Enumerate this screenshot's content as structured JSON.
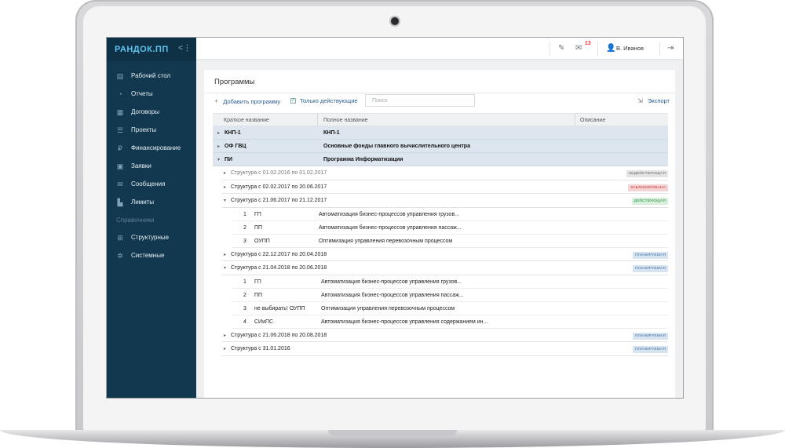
{
  "app": {
    "logo": "РАНДОК.ПП",
    "collapse_icon": "collapse-icon"
  },
  "sidebar": {
    "items": [
      {
        "label": "Рабочий стол",
        "icon": "dashboard-icon"
      },
      {
        "label": "Отчеты",
        "icon": "pie-chart-icon"
      },
      {
        "label": "Договоры",
        "icon": "document-icon"
      },
      {
        "label": "Проекты",
        "icon": "list-icon"
      },
      {
        "label": "Финансирование",
        "icon": "ruble-icon"
      },
      {
        "label": "Заявки",
        "icon": "form-icon"
      },
      {
        "label": "Сообщения",
        "icon": "envelope-icon"
      },
      {
        "label": "Лимиты",
        "icon": "bar-chart-icon"
      }
    ],
    "section_title": "Справочники",
    "refs": [
      {
        "label": "Структурные",
        "icon": "hierarchy-icon"
      },
      {
        "label": "Системные",
        "icon": "gears-icon"
      }
    ]
  },
  "topbar": {
    "notifications_count": "13",
    "user_name": "В. Иванов"
  },
  "panel": {
    "title": "Программы",
    "add_label": "Добавить программу",
    "active_only_label": "Только действующие",
    "search_placeholder": "Поиск",
    "export_label": "Экспорт"
  },
  "table": {
    "columns": [
      "Краткое название",
      "Полное название",
      "Описание"
    ],
    "groups": [
      {
        "code": "КНП-1",
        "full": "КНП-1",
        "arrow": "▸"
      },
      {
        "code": "ОФ ГВЦ",
        "full": "Основные фонды главного вычислительного центра",
        "arrow": "▸"
      },
      {
        "code": "ПИ",
        "full": "Программа Информатизации",
        "arrow": "▾"
      }
    ],
    "structures": [
      {
        "label": "Структура с 01.02.2016  по 01.02.2017",
        "badge": "недействующая",
        "arrow": "▸"
      },
      {
        "label": "Структура с 02.02.2017  по 20.06.2017",
        "badge": "заблокирована",
        "arrow": "▸"
      },
      {
        "label": "Структура с 21.06.2017  по 21.12.2017",
        "badge": "действующая",
        "arrow": "▾",
        "items": [
          {
            "num": "1",
            "code": "ГП",
            "desc": "Автоматизация бизнес-процессов управления грузов..."
          },
          {
            "num": "2",
            "code": "ПП",
            "desc": "Автоматизация бизнес-процессов управления пассаж..."
          },
          {
            "num": "3",
            "code": "ОУПП",
            "desc": "Оптимизация управления перевозочным процессом"
          }
        ]
      },
      {
        "label": "Структура с 22.12.2017  по 20.04.2018",
        "badge": "планируемая",
        "arrow": "▸"
      },
      {
        "label": "Структура с 21.04.2018  по 20.06.2018",
        "badge": "планируемая",
        "arrow": "▾",
        "items": [
          {
            "num": "1",
            "code": "ГП",
            "desc": "Автоматизация бизнес-процессов управления грузов..."
          },
          {
            "num": "2",
            "code": "ПП",
            "desc": "Автоматизация бизнес-процессов управления пассаж..."
          },
          {
            "num": "3",
            "code": "не выбирать! ОУПП",
            "desc": "Оптимизация управления перевозочным процессом"
          },
          {
            "num": "4",
            "code": "СИиПС",
            "desc": "Автоматизация бизнес-процессов управления содержанием ин..."
          }
        ]
      },
      {
        "label": "Структура с 21.06.2018  по 20.08.2018",
        "badge": "планируемая",
        "arrow": "▸"
      },
      {
        "label": "Структура с 31.01.2016",
        "badge": "планируемая",
        "arrow": "▸"
      }
    ]
  }
}
